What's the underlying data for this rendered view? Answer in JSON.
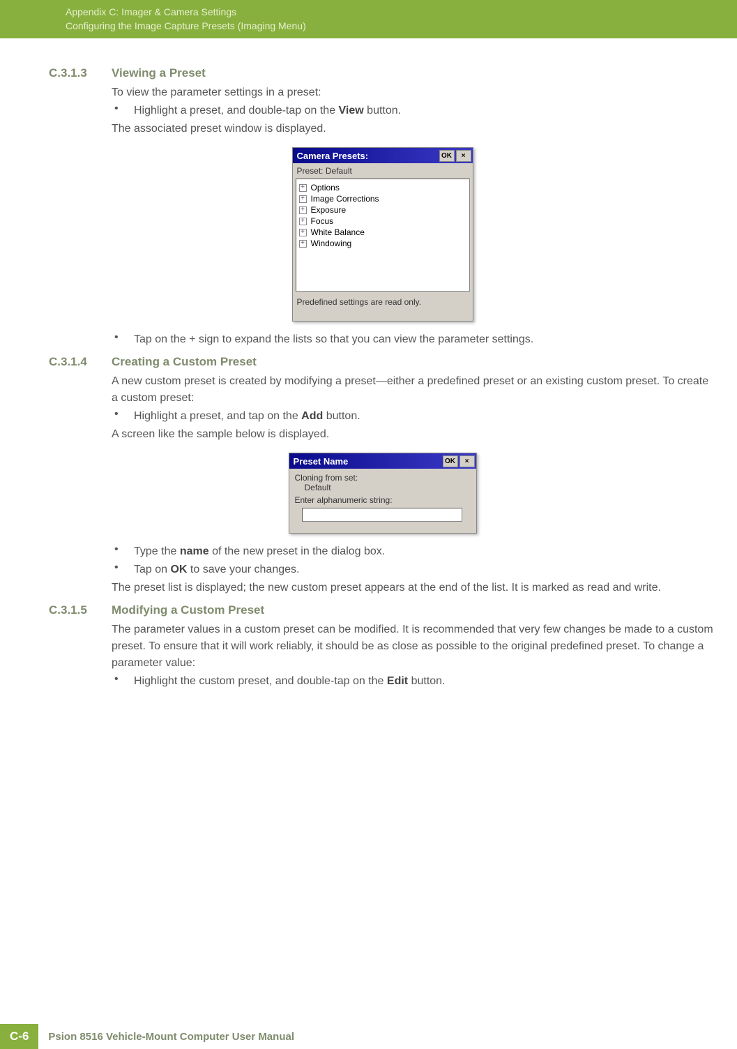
{
  "header": {
    "line1": "Appendix C: Imager & Camera Settings",
    "line2": "Configuring the Image Capture Presets (Imaging Menu)"
  },
  "sec1": {
    "num": "C.3.1.3",
    "title": "Viewing a Preset",
    "p1": "To view the parameter settings in a preset:",
    "b1_pre": "Highlight a preset, and double-tap on the ",
    "b1_bold": "View",
    "b1_post": " button.",
    "p2": "The associated preset window is displayed.",
    "b2": "Tap on the + sign to expand the lists so that you can view the parameter settings."
  },
  "dlg1": {
    "title": "Camera Presets:",
    "ok": "OK",
    "preset_label": "Preset: Default",
    "tree": [
      "Options",
      "Image Corrections",
      "Exposure",
      "Focus",
      "White Balance",
      "Windowing"
    ],
    "footer": "Predefined settings are read only."
  },
  "sec2": {
    "num": "C.3.1.4",
    "title": "Creating a Custom Preset",
    "p1": "A new custom preset is created by modifying a preset—either a predefined preset or an existing custom preset. To create a custom preset:",
    "b1_pre": "Highlight a preset, and tap on the ",
    "b1_bold": "Add",
    "b1_post": " button.",
    "p2": "A screen like the sample below is displayed.",
    "b2_pre": "Type the ",
    "b2_bold": "name",
    "b2_post": " of the new preset in the dialog box.",
    "b3_pre": "Tap on ",
    "b3_bold": "OK",
    "b3_post": " to save your changes.",
    "p3": "The preset list is displayed; the new custom preset appears at the end of the list. It is marked as read and write."
  },
  "dlg2": {
    "title": "Preset Name",
    "ok": "OK",
    "line1": "Cloning from set:",
    "line1b": "Default",
    "line2": "Enter alphanumeric string:",
    "input_value": ""
  },
  "sec3": {
    "num": "C.3.1.5",
    "title": "Modifying a Custom Preset",
    "p1": "The parameter values in a custom preset can be modified. It is recommended that very few changes be made to a custom preset. To ensure that it will work reliably, it should be as close as possible to the original predefined preset. To change a parameter value:",
    "b1_pre": "Highlight the custom preset, and double-tap on the ",
    "b1_bold": "Edit",
    "b1_post": " button."
  },
  "footer": {
    "pagenum": "C-6",
    "text": "Psion 8516 Vehicle-Mount Computer User Manual"
  }
}
